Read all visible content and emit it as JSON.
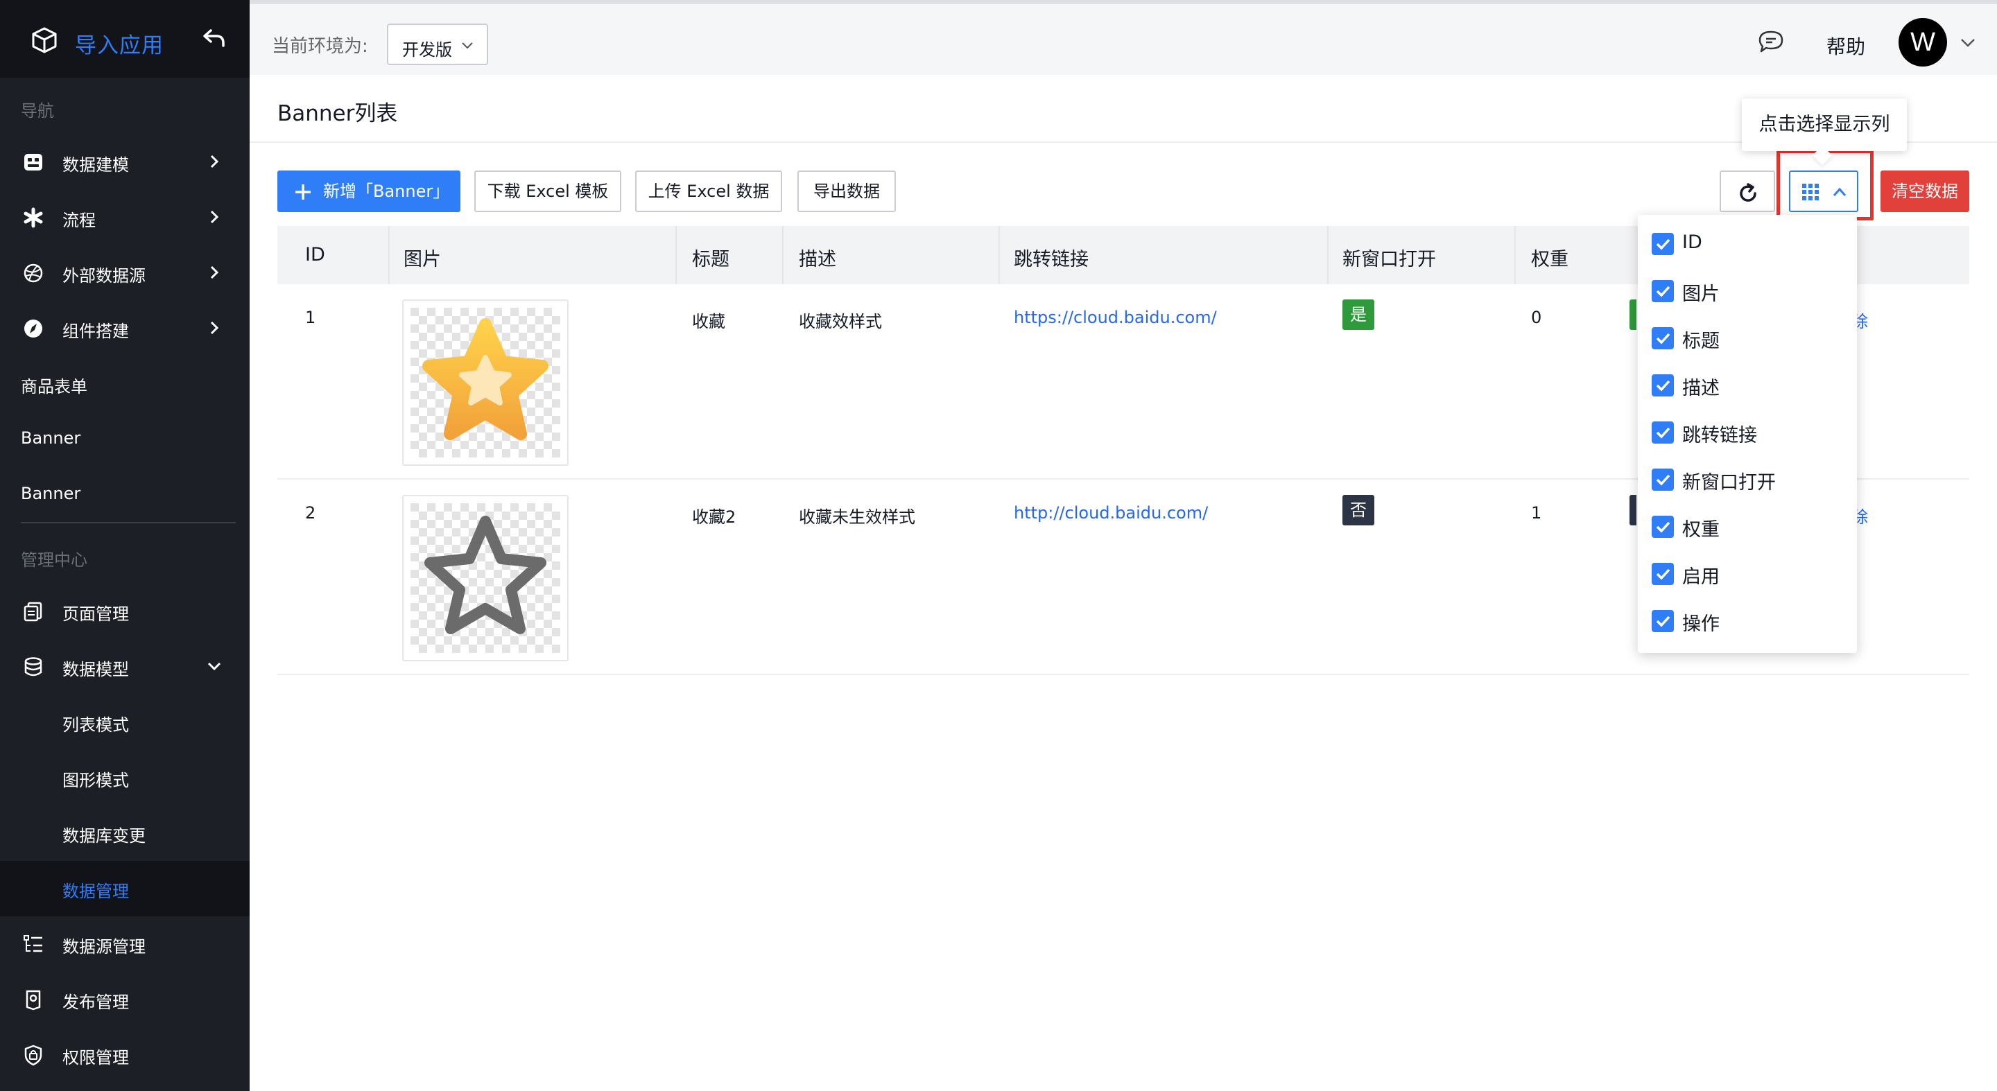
{
  "app": {
    "title": "导入应用"
  },
  "sidebar": {
    "nav_section": "导航",
    "admin_section": "管理中心",
    "items": [
      {
        "label": "数据建模",
        "icon": "data-model-icon"
      },
      {
        "label": "流程",
        "icon": "flow-icon"
      },
      {
        "label": "外部数据源",
        "icon": "external-source-icon"
      },
      {
        "label": "组件搭建",
        "icon": "compass-icon"
      },
      {
        "label": "商品表单"
      },
      {
        "label": "Banner"
      },
      {
        "label": "Banner"
      }
    ],
    "admin_items": [
      {
        "label": "页面管理",
        "icon": "page-icon"
      },
      {
        "label": "数据模型",
        "icon": "database-icon"
      },
      {
        "label": "列表模式"
      },
      {
        "label": "图形模式"
      },
      {
        "label": "数据库变更"
      },
      {
        "label": "数据管理",
        "active": true
      },
      {
        "label": "数据源管理",
        "icon": "datasource-icon"
      },
      {
        "label": "发布管理",
        "icon": "publish-icon"
      },
      {
        "label": "权限管理",
        "icon": "permission-icon"
      }
    ]
  },
  "topbar": {
    "env_label": "当前环境为:",
    "env_value": "开发版",
    "help": "帮助",
    "avatar_letter": "W"
  },
  "page": {
    "title": "Banner列表"
  },
  "toolbar": {
    "add": "新增「Banner」",
    "download": "下载 Excel 模板",
    "upload": "上传 Excel 数据",
    "export": "导出数据",
    "clear": "清空数据",
    "tooltip": "点击选择显示列"
  },
  "table": {
    "columns": [
      "ID",
      "图片",
      "标题",
      "描述",
      "跳转链接",
      "新窗口打开",
      "权重"
    ],
    "rows": [
      {
        "id": "1",
        "title": "收藏",
        "desc": "收藏效样式",
        "link": "https://cloud.baidu.com/",
        "new_window": "是",
        "weight": "0",
        "op": "除"
      },
      {
        "id": "2",
        "title": "收藏2",
        "desc": "收藏未生效样式",
        "link": "http://cloud.baidu.com/",
        "new_window": "否",
        "weight": "1",
        "op": "除"
      }
    ]
  },
  "column_chooser": {
    "options": [
      "ID",
      "图片",
      "标题",
      "描述",
      "跳转链接",
      "新窗口打开",
      "权重",
      "启用",
      "操作"
    ]
  },
  "colors": {
    "accent": "#2f7ef7",
    "danger": "#e2413b",
    "sidebar_bg": "#1c1f26",
    "tag_yes": "#2f9a3c",
    "tag_no": "#2b3546"
  }
}
